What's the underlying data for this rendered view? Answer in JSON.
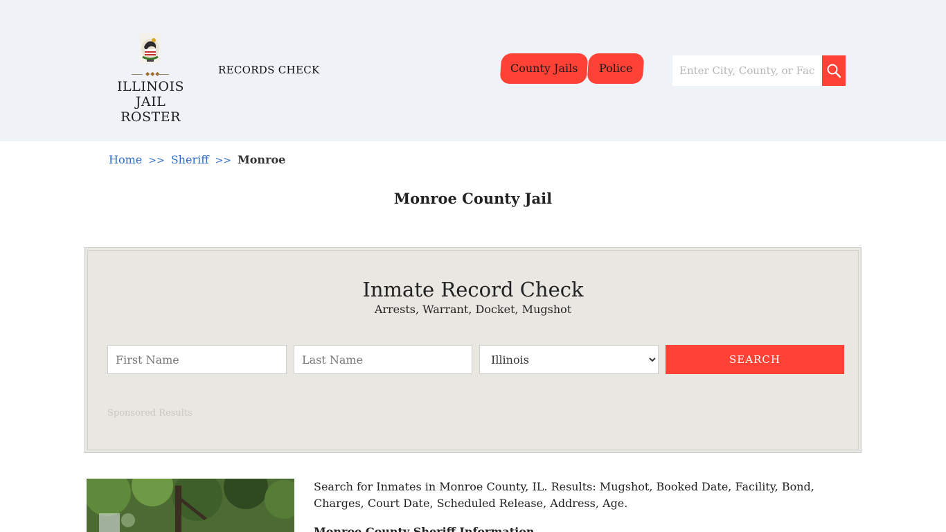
{
  "header": {
    "logo_line1": "ILLINOIS",
    "logo_line2": "JAIL ROSTER",
    "records_check": "RECORDS CHECK",
    "nav": {
      "county_jails": "County Jails",
      "police": "Police"
    },
    "search_placeholder": "Enter City, County, or Facility"
  },
  "breadcrumb": {
    "home": "Home",
    "sheriff": "Sheriff",
    "current": "Monroe",
    "separator": ">>"
  },
  "page_title": "Monroe County Jail",
  "record_check": {
    "title": "Inmate Record Check",
    "subtitle": "Arrests, Warrant, Docket, Mugshot",
    "first_name_placeholder": "First Name",
    "last_name_placeholder": "Last Name",
    "state_selected": "Illinois",
    "search_label": "SEARCH",
    "sponsored": "Sponsored Results"
  },
  "content": {
    "intro": "Search for Inmates in Monroe County, IL. Results: Mugshot, Booked Date, Facility, Bond, Charges, Court Date, Scheduled Release, Address, Age.",
    "subhead": "Monroe County Sheriff Information"
  },
  "colors": {
    "accent": "#ff4136",
    "header_bg": "#eff3f8",
    "panel_bg": "#e9e7e2",
    "link": "#2d6bc9"
  }
}
